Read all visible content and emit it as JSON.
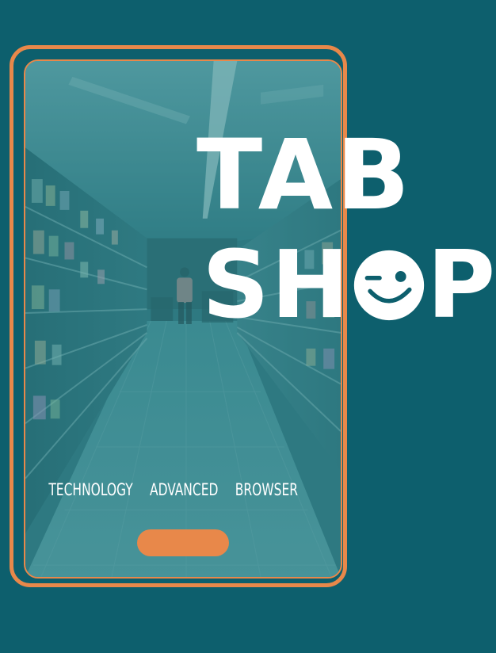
{
  "logo": {
    "line1": "TAB",
    "line2_left": "SH",
    "line2_right": "P"
  },
  "tagline": {
    "word1": "TECHNOLOGY",
    "word2": "ADVANCED",
    "word3": "BROWSER"
  },
  "colors": {
    "background": "#0d5f6d",
    "accent": "#e8884a",
    "text": "#ffffff"
  },
  "icons": {
    "smiley": "winking-face-icon"
  }
}
